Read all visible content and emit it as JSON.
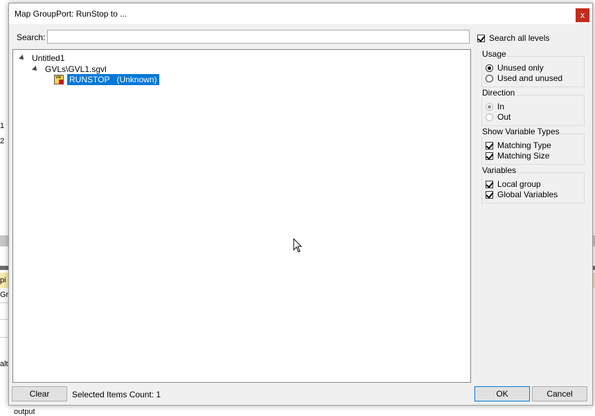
{
  "background": {
    "rows": [
      "1",
      "2",
      "pi",
      "Gro",
      "alt",
      "output"
    ]
  },
  "dialog": {
    "title": "Map GroupPort: RunStop to ...",
    "close_glyph": "x",
    "search": {
      "label": "Search:",
      "value": "",
      "placeholder": ""
    },
    "search_all_levels": {
      "label": "Search all levels",
      "checked": true
    },
    "tree": {
      "root": "Untitled1",
      "child": "GVLs\\GVL1.sgvl",
      "item": {
        "icon": "var-icon",
        "icon_text": "Var",
        "name": "RUNSTOP",
        "type": "(Unknown)"
      }
    },
    "usage": {
      "title": "Usage",
      "unused_only": "Unused only",
      "used_and_unused": "Used and unused"
    },
    "direction": {
      "title": "Direction",
      "in": "In",
      "out": "Out"
    },
    "show_types": {
      "title": "Show Variable Types",
      "matching_type": "Matching Type",
      "matching_size": "Matching Size"
    },
    "variables": {
      "title": "Variables",
      "local_group": "Local group",
      "global_variables": "Global Variables"
    },
    "clear_label": "Clear",
    "status_text": "Selected Items Count: 1",
    "ok_label": "OK",
    "cancel_label": "Cancel"
  },
  "colors": {
    "selection": "#0078d7",
    "close_button": "#c42b1c"
  }
}
